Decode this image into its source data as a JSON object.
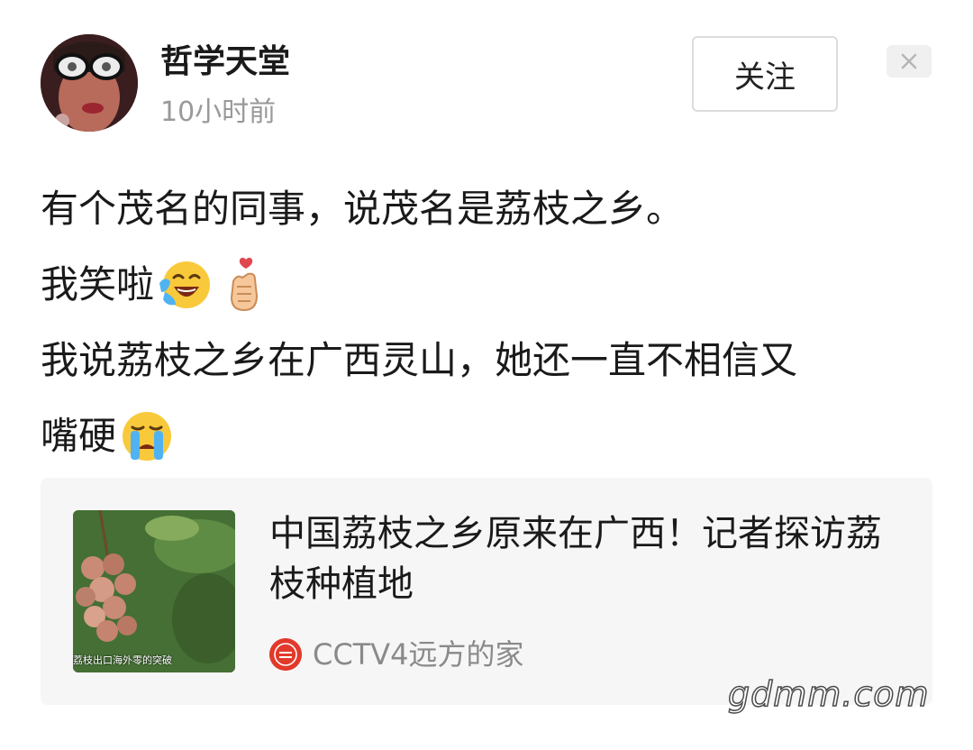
{
  "post": {
    "author": {
      "name": "哲学天堂",
      "timestamp": "10小时前"
    },
    "follow_label": "关注",
    "close_label": "×",
    "lines": [
      "有个茂名的同事，说茂名是荔枝之乡。",
      "我笑啦",
      "我说荔枝之乡在广西灵山，她还一直不相信又",
      "嘴硬"
    ],
    "emojis": [
      "laughing-crying-emoji",
      "finger-heart-emoji",
      "loudly-crying-emoji"
    ]
  },
  "article": {
    "title": "中国荔枝之乡原来在广西！记者探访荔枝种植地",
    "thumbnail_caption": "荔枝出口海外零的突破",
    "source_name": "CCTV4远方的家",
    "source_icon_text": "远方的家",
    "colors": {
      "card_bg": "#f6f6f6",
      "source_icon": "#e2392b"
    }
  },
  "watermark": "gdmm.com"
}
